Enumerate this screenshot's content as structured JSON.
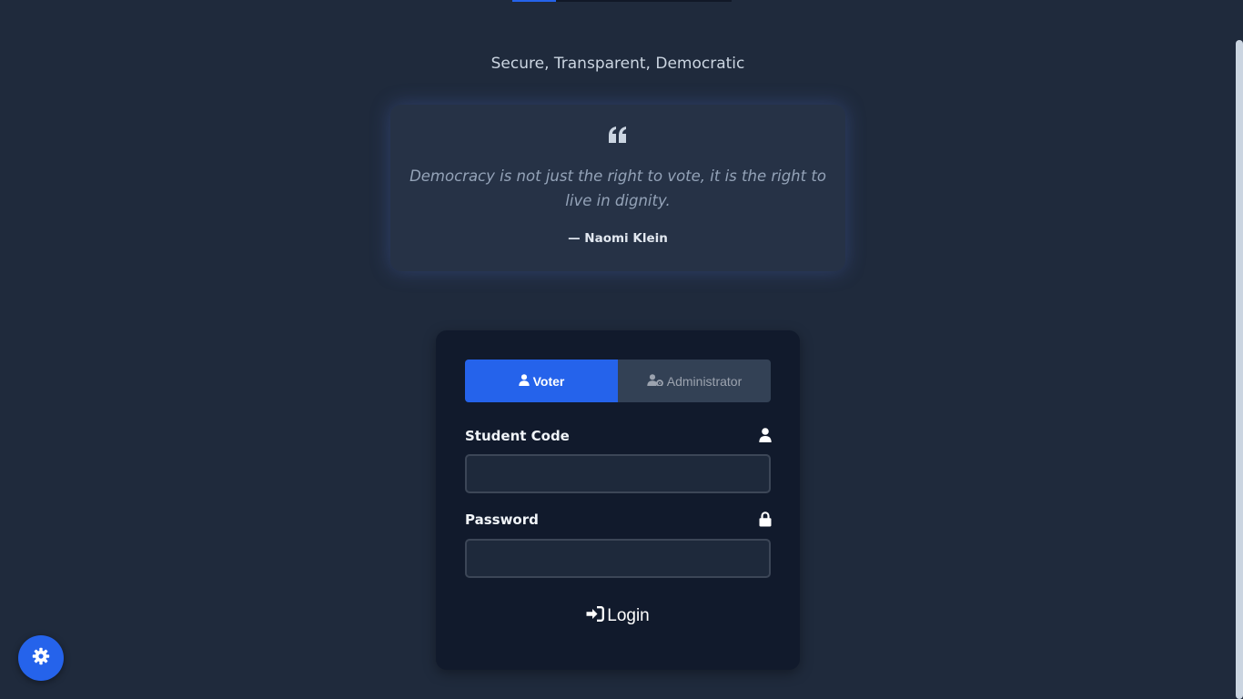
{
  "header": {
    "tagline": "Secure, Transparent, Democratic",
    "progress_fraction": 0.2
  },
  "quote": {
    "icon": "quote-left-icon",
    "text": "Democracy is not just the right to vote, it is the right to live in dignity.",
    "author": "— Naomi Klein"
  },
  "login": {
    "tabs": [
      {
        "label": "Voter",
        "icon": "user-icon",
        "active": true
      },
      {
        "label": "Administrator",
        "icon": "user-gear-icon",
        "active": false
      }
    ],
    "student_code": {
      "label": "Student Code",
      "value": "",
      "placeholder": "",
      "icon": "user-icon"
    },
    "password": {
      "label": "Password",
      "value": "",
      "placeholder": "",
      "icon": "lock-icon"
    },
    "submit_label": "Login",
    "submit_icon": "sign-in-icon"
  },
  "settings": {
    "icon": "gear-icon"
  },
  "colors": {
    "background": "#1f2a3c",
    "card": "#111a2c",
    "quote_card": "#263246",
    "accent": "#2563eb",
    "tab_inactive": "#334155",
    "input_bg": "#1e293b"
  }
}
